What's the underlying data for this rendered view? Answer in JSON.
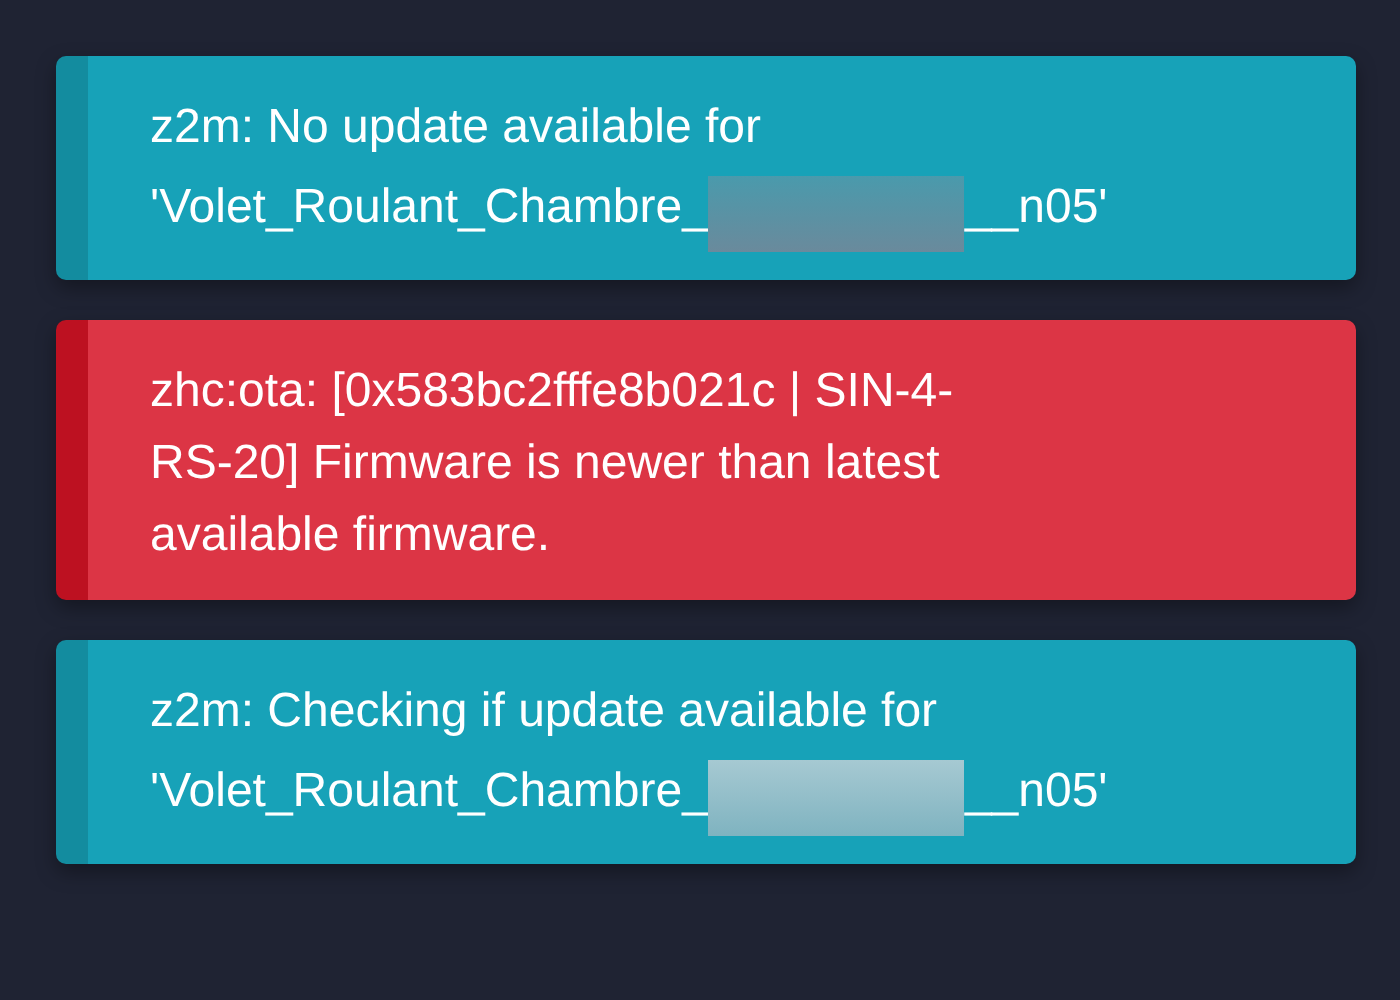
{
  "notifications": [
    {
      "kind": "info",
      "lines": [
        "z2m: No update available for",
        "'Volet_Roulant_Chambre_"
      ],
      "redacted": true,
      "text_after": "__n05'"
    },
    {
      "kind": "error",
      "lines": [
        "zhc:ota: [0x583bc2fffe8b021c | SIN-4-",
        "RS-20] Firmware is newer than latest",
        "available firmware."
      ],
      "redacted": false
    },
    {
      "kind": "info",
      "lines": [
        "z2m: Checking if update available for",
        "'Volet_Roulant_Chambre_"
      ],
      "redacted": true,
      "text_after": "__n05'"
    }
  ]
}
